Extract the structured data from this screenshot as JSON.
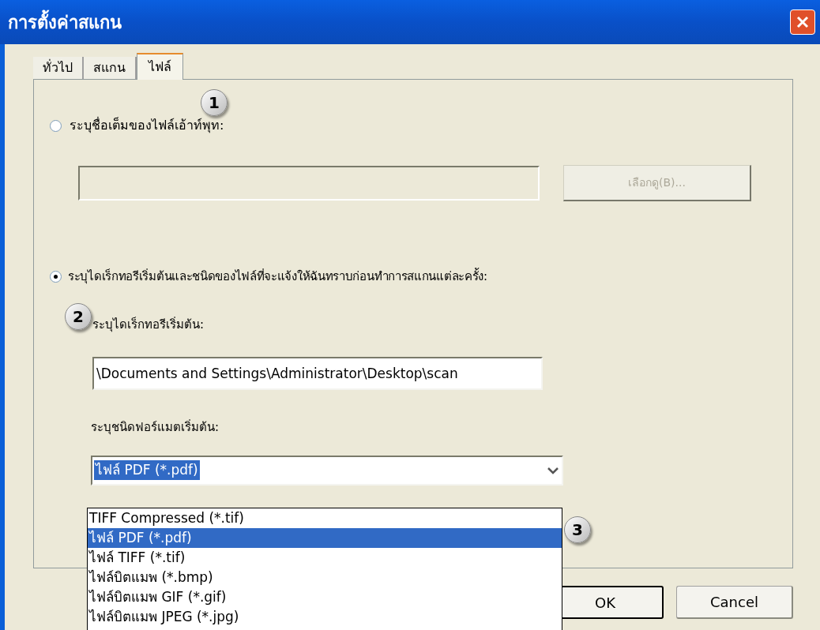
{
  "window": {
    "title": "การตั้งค่าสแกน"
  },
  "tabs": [
    {
      "label": "ทั่วไป",
      "selected": false
    },
    {
      "label": "สแกน",
      "selected": false
    },
    {
      "label": "ไฟล์",
      "selected": true
    }
  ],
  "output_file": {
    "label": "ระบุชื่อเต็มของไฟล์เอ้าท์พุท:",
    "selected": false,
    "browse_button": {
      "label": "เลือกดู(B)...",
      "disabled": true
    }
  },
  "directory_option": {
    "label": "ระบุไดเร็กทอรีเริ่มต้นและชนิดของไฟล์ที่จะแจ้งให้ฉันทราบก่อนทำการสแกนแต่ละครั้ง:",
    "selected": true,
    "directory_label": "ระบุไดเร็กทอรีเริ่มต้น:",
    "directory_value": "\\Documents and Settings\\Administrator\\Desktop\\scan",
    "format_label": "ระบุชนิดฟอร์แมตเริ่มต้น:",
    "format_value": "ไฟล์ PDF  (*.pdf)"
  },
  "format_list": [
    {
      "label": "TIFF Compressed  (*.tif)",
      "selected": false
    },
    {
      "label": "ไฟล์ PDF  (*.pdf)",
      "selected": true
    },
    {
      "label": "ไฟล์ TIFF  (*.tif)",
      "selected": false
    },
    {
      "label": "ไฟล์บิตแมพ (*.bmp)",
      "selected": false
    },
    {
      "label": "ไฟล์บิตแมพ GIF  (*.gif)",
      "selected": false
    },
    {
      "label": "ไฟล์บิตแมพ JPEG  (*.jpg)",
      "selected": false
    }
  ],
  "buttons": [
    "OK",
    "Cancel"
  ],
  "callouts": [
    "1",
    "2",
    "3"
  ]
}
